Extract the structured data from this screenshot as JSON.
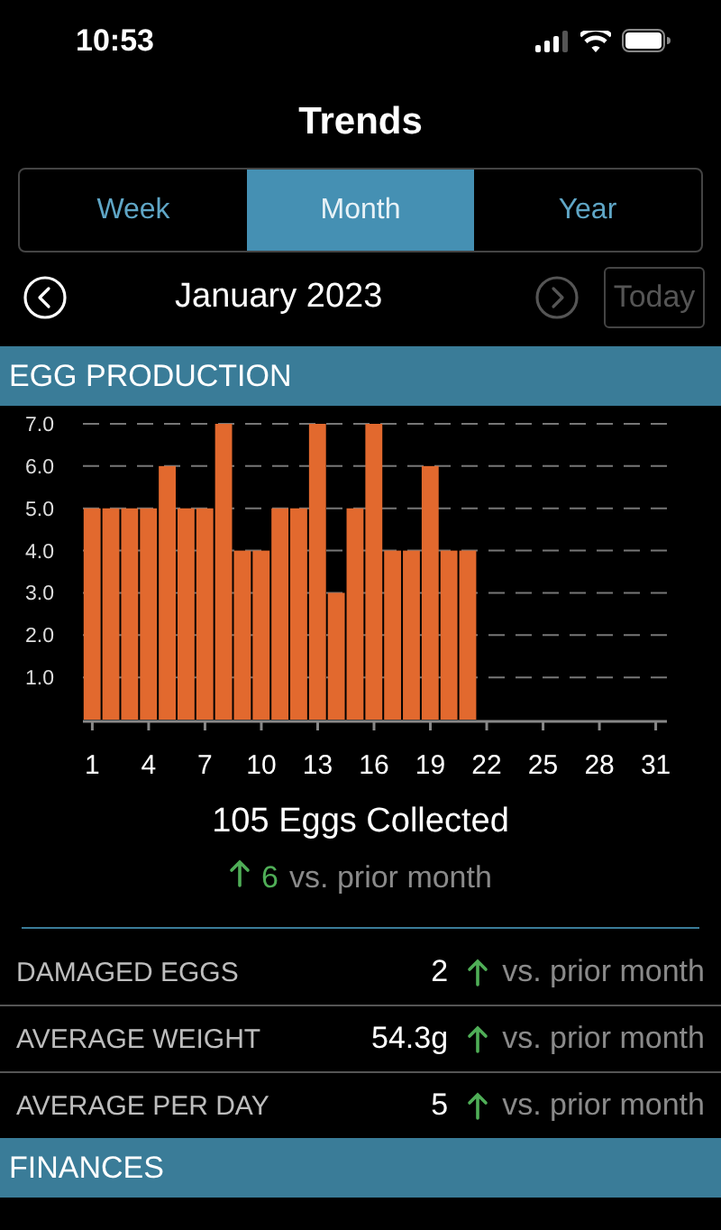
{
  "status_bar": {
    "time": "10:53"
  },
  "title": "Trends",
  "tabs": [
    {
      "label": "Week",
      "selected": false
    },
    {
      "label": "Month",
      "selected": true
    },
    {
      "label": "Year",
      "selected": false
    }
  ],
  "nav": {
    "label": "January 2023",
    "prev": {
      "disabled": false
    },
    "next": {
      "disabled": true
    },
    "today": {
      "label": "Today",
      "disabled": true
    }
  },
  "sections": [
    {
      "title": "EGG PRODUCTION",
      "chart_data": {
        "type": "bar",
        "grid": true,
        "x": [
          1,
          2,
          3,
          4,
          5,
          6,
          7,
          8,
          9,
          10,
          11,
          12,
          13,
          14,
          15,
          16,
          17,
          18,
          19,
          20,
          21
        ],
        "series": [
          {
            "color": "#e2692e",
            "values": [
              5,
              5,
              5,
              5,
              6,
              5,
              5,
              7,
              4,
              4,
              5,
              5,
              7,
              3,
              5,
              7,
              4,
              4,
              6,
              4,
              4
            ]
          }
        ],
        "xlim": [
          0.5,
          31.5
        ],
        "ylim": [
          0,
          7
        ],
        "yticks": [
          {
            "value": 1,
            "label": "1.0"
          },
          {
            "value": 2,
            "label": "2.0"
          },
          {
            "value": 3,
            "label": "3.0"
          },
          {
            "value": 4,
            "label": "4.0"
          },
          {
            "value": 5,
            "label": "5.0"
          },
          {
            "value": 6,
            "label": "6.0"
          },
          {
            "value": 7,
            "label": "7.0"
          }
        ],
        "xticks": [
          1,
          4,
          7,
          10,
          13,
          16,
          19,
          22,
          25,
          28,
          31
        ]
      },
      "total": "105 Eggs Collected",
      "change": {
        "increase": true,
        "value": "6",
        "suffix": "vs. prior month"
      },
      "rows": [
        {
          "label": "DAMAGED EGGS",
          "value": "2",
          "increase": true,
          "suffix": "vs. prior month"
        },
        {
          "label": "AVERAGE WEIGHT",
          "value": "54.3g",
          "increase": true,
          "suffix": "vs. prior month"
        },
        {
          "label": "AVERAGE PER DAY",
          "value": "5",
          "increase": true,
          "suffix": "vs. prior month"
        }
      ]
    },
    {
      "title": "FINANCES"
    }
  ]
}
